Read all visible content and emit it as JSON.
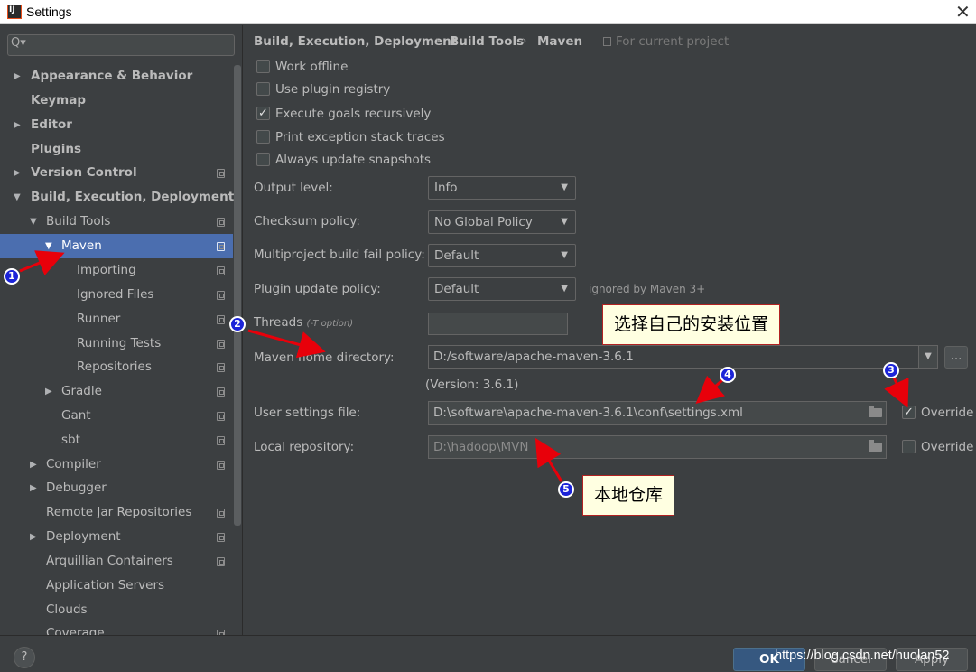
{
  "window": {
    "title": "Settings",
    "close_glyph": "✕"
  },
  "sidebar": {
    "search_glyph": "Q▾",
    "items": [
      {
        "label": "Appearance & Behavior"
      },
      {
        "label": "Keymap"
      },
      {
        "label": "Editor"
      },
      {
        "label": "Plugins"
      },
      {
        "label": "Version Control"
      },
      {
        "label": "Build, Execution, Deployment"
      },
      {
        "label": "Build Tools"
      },
      {
        "label": "Maven"
      },
      {
        "label": "Importing"
      },
      {
        "label": "Ignored Files"
      },
      {
        "label": "Runner"
      },
      {
        "label": "Running Tests"
      },
      {
        "label": "Repositories"
      },
      {
        "label": "Gradle"
      },
      {
        "label": "Gant"
      },
      {
        "label": "sbt"
      },
      {
        "label": "Compiler"
      },
      {
        "label": "Debugger"
      },
      {
        "label": "Remote Jar Repositories"
      },
      {
        "label": "Deployment"
      },
      {
        "label": "Arquillian Containers"
      },
      {
        "label": "Application Servers"
      },
      {
        "label": "Clouds"
      },
      {
        "label": "Coverage"
      }
    ]
  },
  "breadcrumb": {
    "items": [
      "Build, Execution, Deployment",
      "Build Tools",
      "Maven"
    ],
    "separator": "›",
    "scope": "For current project"
  },
  "checkboxes": [
    {
      "label": "Work offline",
      "checked": false
    },
    {
      "label": "Use plugin registry",
      "checked": false
    },
    {
      "label": "Execute goals recursively",
      "checked": true
    },
    {
      "label": "Print exception stack traces",
      "checked": false
    },
    {
      "label": "Always update snapshots",
      "checked": false
    }
  ],
  "check_glyph": "✓",
  "fields": {
    "output_level": {
      "label": "Output level:",
      "value": "Info"
    },
    "checksum_policy": {
      "label": "Checksum policy:",
      "value": "No Global Policy"
    },
    "multiproject": {
      "label": "Multiproject build fail policy:",
      "value": "Default"
    },
    "plugin_update": {
      "label": "Plugin update policy:",
      "value": "Default",
      "hint": "ignored by Maven 3+"
    },
    "threads": {
      "label": "Threads",
      "sub": "(-T option)"
    },
    "maven_home": {
      "label": "Maven home directory:",
      "value": "D:/software/apache-maven-3.6.1",
      "version": "(Version: 3.6.1)",
      "browse": "..."
    },
    "user_settings": {
      "label": "User settings file:",
      "value": "D:\\software\\apache-maven-3.6.1\\conf\\settings.xml",
      "override": "Override",
      "override_checked": true
    },
    "local_repo": {
      "label": "Local repository:",
      "value": "D:\\hadoop\\MVN",
      "override": "Override",
      "override_checked": false
    }
  },
  "caret_glyph": "▼",
  "annotations": {
    "callout_1": "选择自己的安装位置",
    "callout_2": "本地仓库",
    "markers": [
      "1",
      "2",
      "3",
      "4",
      "5"
    ],
    "arrow_color": "#e8000a"
  },
  "footer": {
    "help": "?",
    "ok": "OK",
    "cancel": "Cancel",
    "apply": "Apply",
    "watermark": "https://blog.csdn.net/huolan52"
  },
  "colors": {
    "background": "#3c3f41",
    "selection": "#4b6eaf",
    "text": "#bbbbbb"
  }
}
